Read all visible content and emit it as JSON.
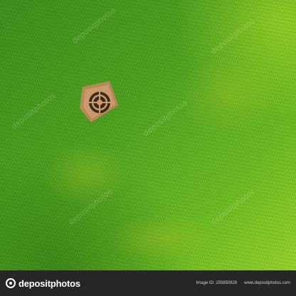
{
  "watermark": {
    "brand": "depositphotos",
    "diagonal_text": "depositphotos",
    "image_id": "Image ID: 255850828",
    "site": "www.depositphotos.com"
  },
  "scene": {
    "subject_icon": "drain-grate-icon"
  }
}
